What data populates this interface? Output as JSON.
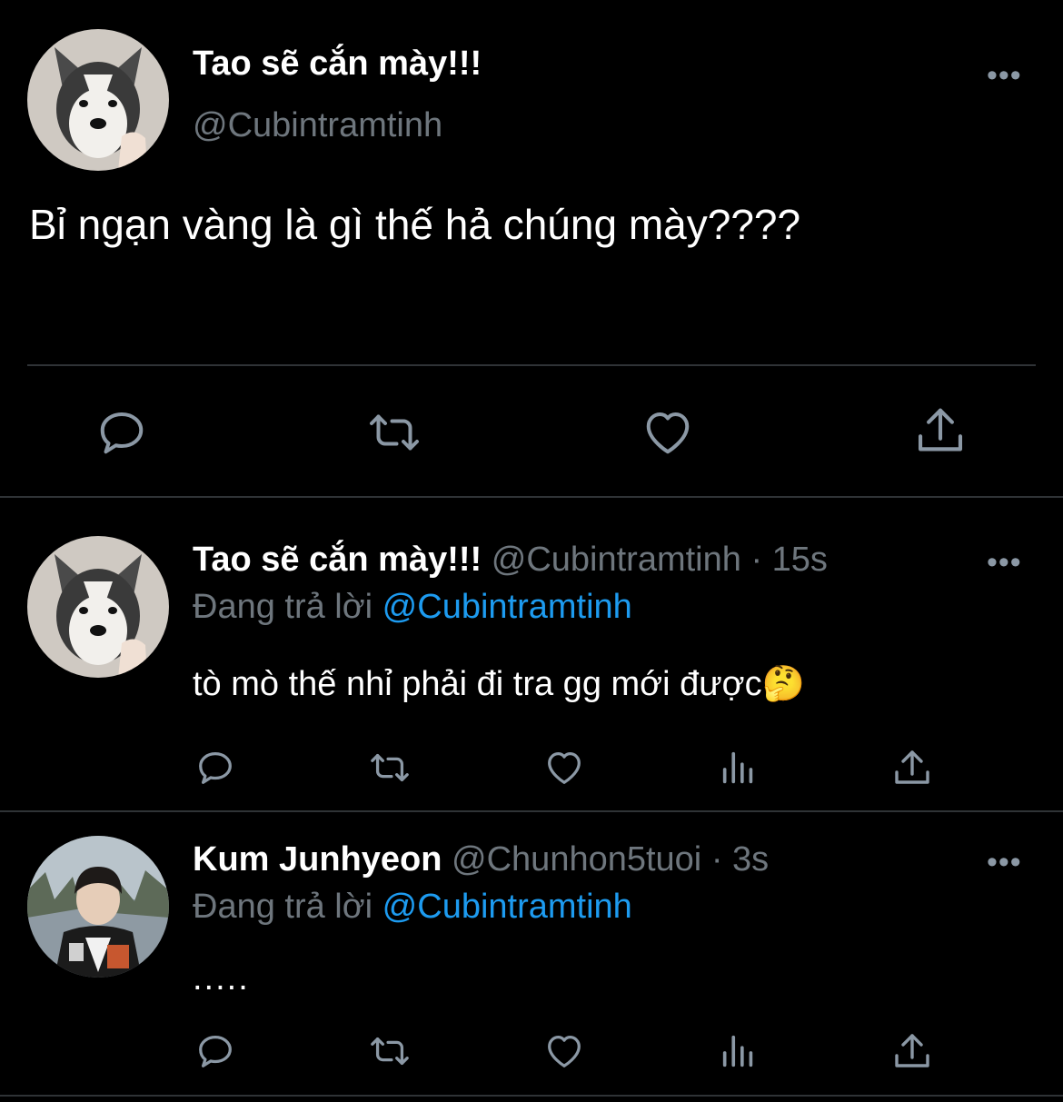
{
  "main_tweet": {
    "display_name": "Tao sẽ cắn mày!!!",
    "handle": "@Cubintramtinh",
    "text": "Bỉ ngạn vàng là gì thế hả chúng mày????",
    "more_label": "•••"
  },
  "replies": [
    {
      "display_name": "Tao sẽ cắn mày!!!",
      "handle": "@Cubintramtinh",
      "time": "· 15s",
      "replying_prefix": "Đang trả lời",
      "replying_to": "@Cubintramtinh",
      "text": "tò mò thế nhỉ phải đi tra gg mới được🤔",
      "more_label": "•••"
    },
    {
      "display_name": "Kum Junhyeon",
      "handle": "@Chunhon5tuoi",
      "time": "· 3s",
      "replying_prefix": "Đang trả lời",
      "replying_to": "@Cubintramtinh",
      "text": ".....",
      "more_label": "•••"
    }
  ],
  "icons": {
    "reply": "reply-icon",
    "retweet": "retweet-icon",
    "like": "like-icon",
    "share": "share-icon",
    "analytics": "analytics-icon"
  },
  "colors": {
    "background": "#000000",
    "text": "#e7e9ea",
    "muted": "#6e767d",
    "link": "#1d9bf0",
    "divider": "#2f3336",
    "icon": "#8b98a5"
  }
}
